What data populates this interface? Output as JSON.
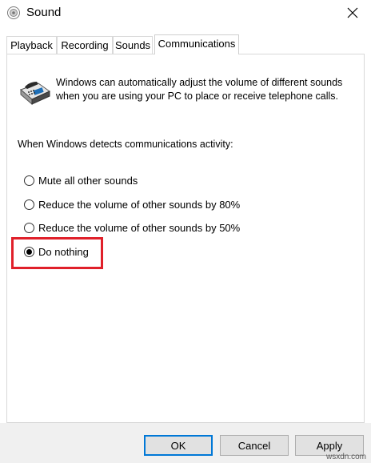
{
  "window": {
    "title": "Sound",
    "app_icon": "speaker-icon",
    "close_icon": "close-icon"
  },
  "tabs": [
    {
      "label": "Playback"
    },
    {
      "label": "Recording"
    },
    {
      "label": "Sounds"
    },
    {
      "label": "Communications",
      "active": true
    }
  ],
  "communications": {
    "icon": "telephone-icon",
    "description": "Windows can automatically adjust the volume of different sounds when you are using your PC to place or receive telephone calls.",
    "detect_label": "When Windows detects communications activity:",
    "options": [
      {
        "label": "Mute all other sounds",
        "selected": false
      },
      {
        "label": "Reduce the volume of other sounds by 80%",
        "selected": false
      },
      {
        "label": "Reduce the volume of other sounds by 50%",
        "selected": false
      },
      {
        "label": "Do nothing",
        "selected": true
      }
    ],
    "highlight_color": "#e0202a"
  },
  "buttons": {
    "ok": "OK",
    "cancel": "Cancel",
    "apply": "Apply"
  },
  "watermark": "wsxdn.com"
}
